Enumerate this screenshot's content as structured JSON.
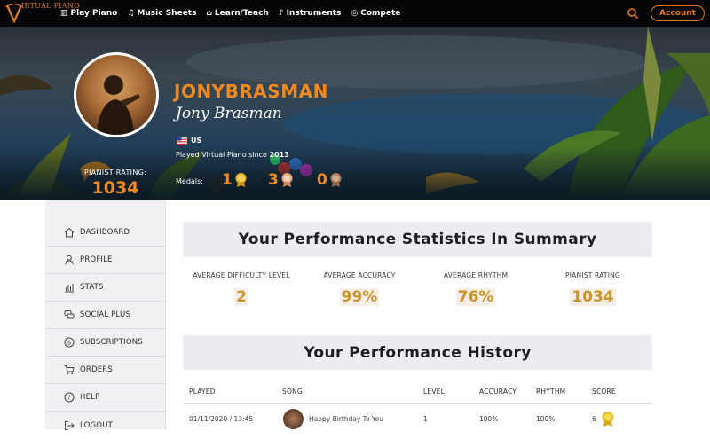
{
  "nav": {
    "logo_text": "IRTUAL PIANO",
    "items": [
      {
        "label": "Play Piano",
        "icon": "piano-icon"
      },
      {
        "label": "Music Sheets",
        "icon": "music-notes-icon"
      },
      {
        "label": "Learn/Teach",
        "icon": "graduation-cap-icon"
      },
      {
        "label": "Instruments",
        "icon": "guitar-icon"
      },
      {
        "label": "Compete",
        "icon": "target-icon"
      }
    ],
    "account_label": "Account"
  },
  "profile": {
    "username": "JONYBRASMAN",
    "full_name": "Jony Brasman",
    "country": "US",
    "since_prefix": "Played Virtual Piano since",
    "since_year": "2013",
    "rating_label": "PIANIST RATING:",
    "rating_value": "1034",
    "medals_label": "Medals:",
    "medals": {
      "gold": "1",
      "silver": "3",
      "bronze": "0"
    }
  },
  "sidebar": {
    "items": [
      {
        "label": "DASHBOARD",
        "icon": "home-icon"
      },
      {
        "label": "PROFILE",
        "icon": "user-icon"
      },
      {
        "label": "STATS",
        "icon": "chart-icon"
      },
      {
        "label": "SOCIAL PLUS",
        "icon": "chat-icon"
      },
      {
        "label": "SUBSCRIPTIONS",
        "icon": "dollar-icon"
      },
      {
        "label": "ORDERS",
        "icon": "cart-icon"
      },
      {
        "label": "HELP",
        "icon": "help-icon"
      },
      {
        "label": "LOGOUT",
        "icon": "logout-icon"
      }
    ]
  },
  "stats": {
    "title": "Your Performance Statistics In Summary",
    "items": [
      {
        "label": "AVERAGE DIFFICULTY LEVEL",
        "value": "2"
      },
      {
        "label": "AVERAGE ACCURACY",
        "value": "99%"
      },
      {
        "label": "AVERAGE RHYTHM",
        "value": "76%"
      },
      {
        "label": "PIANIST RATING",
        "value": "1034"
      }
    ]
  },
  "history": {
    "title": "Your Performance History",
    "columns": [
      "PLAYED",
      "SONG",
      "LEVEL",
      "ACCURACY",
      "RHYTHM",
      "SCORE"
    ],
    "rows": [
      {
        "played": "01/11/2020 / 13:45",
        "song": "Happy Birthday To You",
        "level": "1",
        "accuracy": "100%",
        "rhythm": "100%",
        "score": "6"
      }
    ]
  },
  "colors": {
    "accent": "#f0891f",
    "stat_value": "#c9952a",
    "nav_bg": "#050505",
    "panel_bg": "#ecedf2"
  }
}
